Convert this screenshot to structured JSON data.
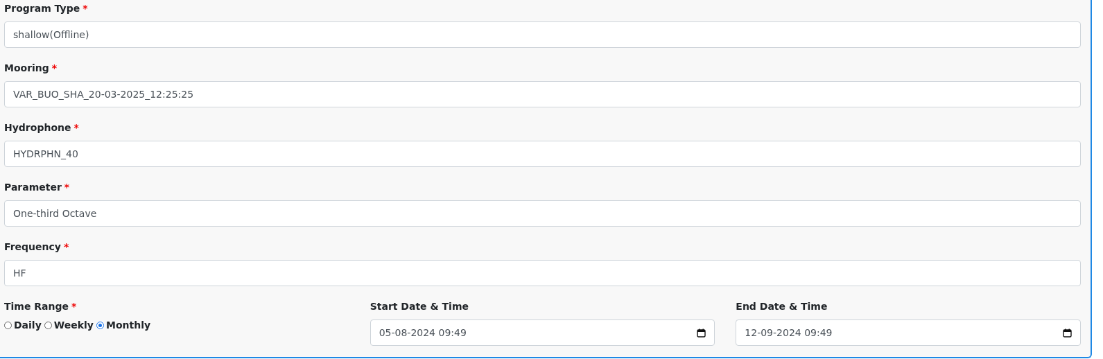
{
  "fields": [
    {
      "label": "Program Type",
      "marker": "*",
      "value": "shallow(Offline)"
    },
    {
      "label": "Mooring",
      "marker": "*",
      "value": "VAR_BUO_SHA_20-03-2025_12:25:25"
    },
    {
      "label": "Hydrophone",
      "marker": "*",
      "value": "HYDRPHN_40"
    },
    {
      "label": "Parameter",
      "marker": "*",
      "value": "One-third Octave"
    },
    {
      "label": "Frequency",
      "marker": "*",
      "value": "HF"
    }
  ],
  "time_range": {
    "label": "Time Range",
    "marker": "*",
    "options": [
      {
        "label": "Daily",
        "selected": false
      },
      {
        "label": "Weekly",
        "selected": false
      },
      {
        "label": "Monthly",
        "selected": true
      }
    ]
  },
  "start": {
    "label": "Start Date & Time",
    "value": "05-08-2024 09:49"
  },
  "end": {
    "label": "End Date & Time",
    "value": "12-09-2024 09:49"
  }
}
